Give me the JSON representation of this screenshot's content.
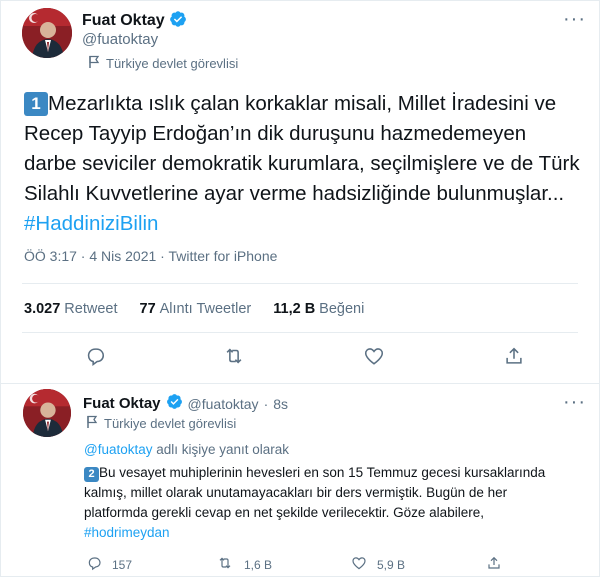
{
  "main_tweet": {
    "author_name": "Fuat Oktay",
    "handle": "@fuatoktay",
    "gov_label": "Türkiye devlet görevlisi",
    "number_badge": "1",
    "text": "Mezarlıkta ıslık çalan korkaklar misali, Millet İradesini ve Recep Tayyip Erdoğan’ın dik duruşunu hazmedemeyen darbe seviciler demokratik kurumlara, seçilmişlere ve de Türk Silahlı Kuvvetlerine ayar verme hadsizliğinde bulunmuşlar... ",
    "hashtag": "#HaddiniziBilin",
    "timestamp": "ÖÖ 3:17 · 4 Nis 2021 · Twitter for iPhone",
    "stats": {
      "retweets_count": "3.027",
      "retweets_label": "Retweet",
      "quotes_count": "77",
      "quotes_label": "Alıntı Tweetler",
      "likes_count": "11,2 B",
      "likes_label": "Beğeni"
    }
  },
  "reply_tweet": {
    "author_name": "Fuat Oktay",
    "handle": "@fuatoktay",
    "separator": "·",
    "time": "8s",
    "gov_label": "Türkiye devlet görevlisi",
    "reply_to_handle": "@fuatoktay",
    "reply_to_suffix": " adlı kişiye yanıt olarak",
    "number_badge": "2",
    "text": "Bu vesayet muhiplerinin hevesleri en son 15 Temmuz gecesi kursaklarında kalmış, millet olarak unutamayacakları bir ders vermiştik. Bugün de her platformda gerekli cevap en net şekilde verilecektir. Göze alabilere, ",
    "hashtag": "#hodrimeydan",
    "reply_count": "157",
    "retweet_count": "1,6 B",
    "like_count": "5,9 B"
  },
  "colors": {
    "accent": "#1da1f2",
    "verified": "#1da1f2",
    "muted": "#5b7083",
    "badge": "#3b88c3",
    "avatar_bg": "#8a1f25"
  },
  "icons": [
    "verified-icon",
    "flag-icon",
    "more-icon",
    "reply-icon",
    "retweet-icon",
    "like-icon",
    "share-icon"
  ]
}
